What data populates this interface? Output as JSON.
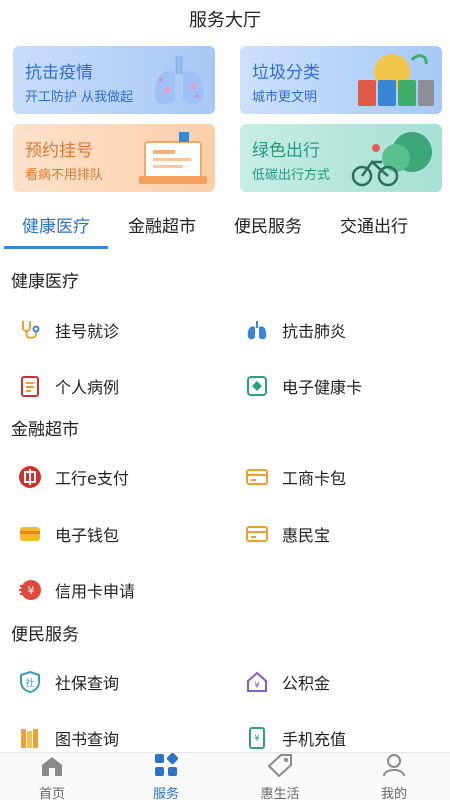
{
  "header": {
    "title": "服务大厅"
  },
  "banners": [
    {
      "title": "抗击疫情",
      "subtitle": "开工防护 从我做起"
    },
    {
      "title": "垃圾分类",
      "subtitle": "城市更文明"
    },
    {
      "title": "预约挂号",
      "subtitle": "看病不用排队"
    },
    {
      "title": "绿色出行",
      "subtitle": "低碳出行方式"
    }
  ],
  "tabs": [
    {
      "label": "健康医疗",
      "active": true
    },
    {
      "label": "金融超市"
    },
    {
      "label": "便民服务"
    },
    {
      "label": "交通出行"
    }
  ],
  "sections": {
    "health": {
      "title": "健康医疗",
      "items": [
        {
          "label": "挂号就诊",
          "icon": "stethoscope-icon"
        },
        {
          "label": "抗击肺炎",
          "icon": "lungs-icon"
        },
        {
          "label": "个人病例",
          "icon": "medical-record-icon"
        },
        {
          "label": "电子健康卡",
          "icon": "health-card-icon"
        }
      ]
    },
    "finance": {
      "title": "金融超市",
      "items": [
        {
          "label": "工行e支付",
          "icon": "icbc-pay-icon"
        },
        {
          "label": "工商卡包",
          "icon": "card-wallet-icon"
        },
        {
          "label": "电子钱包",
          "icon": "e-wallet-icon"
        },
        {
          "label": "惠民宝",
          "icon": "huiminbao-icon"
        },
        {
          "label": "信用卡申请",
          "icon": "credit-card-apply-icon"
        }
      ]
    },
    "convenience": {
      "title": "便民服务",
      "items": [
        {
          "label": "社保查询",
          "icon": "social-security-icon"
        },
        {
          "label": "公积金",
          "icon": "housing-fund-icon"
        },
        {
          "label": "图书查询",
          "icon": "book-icon"
        },
        {
          "label": "手机充值",
          "icon": "phone-recharge-icon"
        }
      ]
    }
  },
  "tabbar": [
    {
      "label": "首页",
      "icon": "home-icon"
    },
    {
      "label": "服务",
      "icon": "services-grid-icon",
      "active": true
    },
    {
      "label": "惠生活",
      "icon": "tag-icon"
    },
    {
      "label": "我的",
      "icon": "user-icon"
    }
  ],
  "colors": {
    "accent": "#2b73c8",
    "tab_underline": "#3a86d6",
    "icon_orange": "#f0a030",
    "icon_red": "#d0302a",
    "icon_blue": "#3a86d6",
    "icon_green": "#2ea07c"
  }
}
